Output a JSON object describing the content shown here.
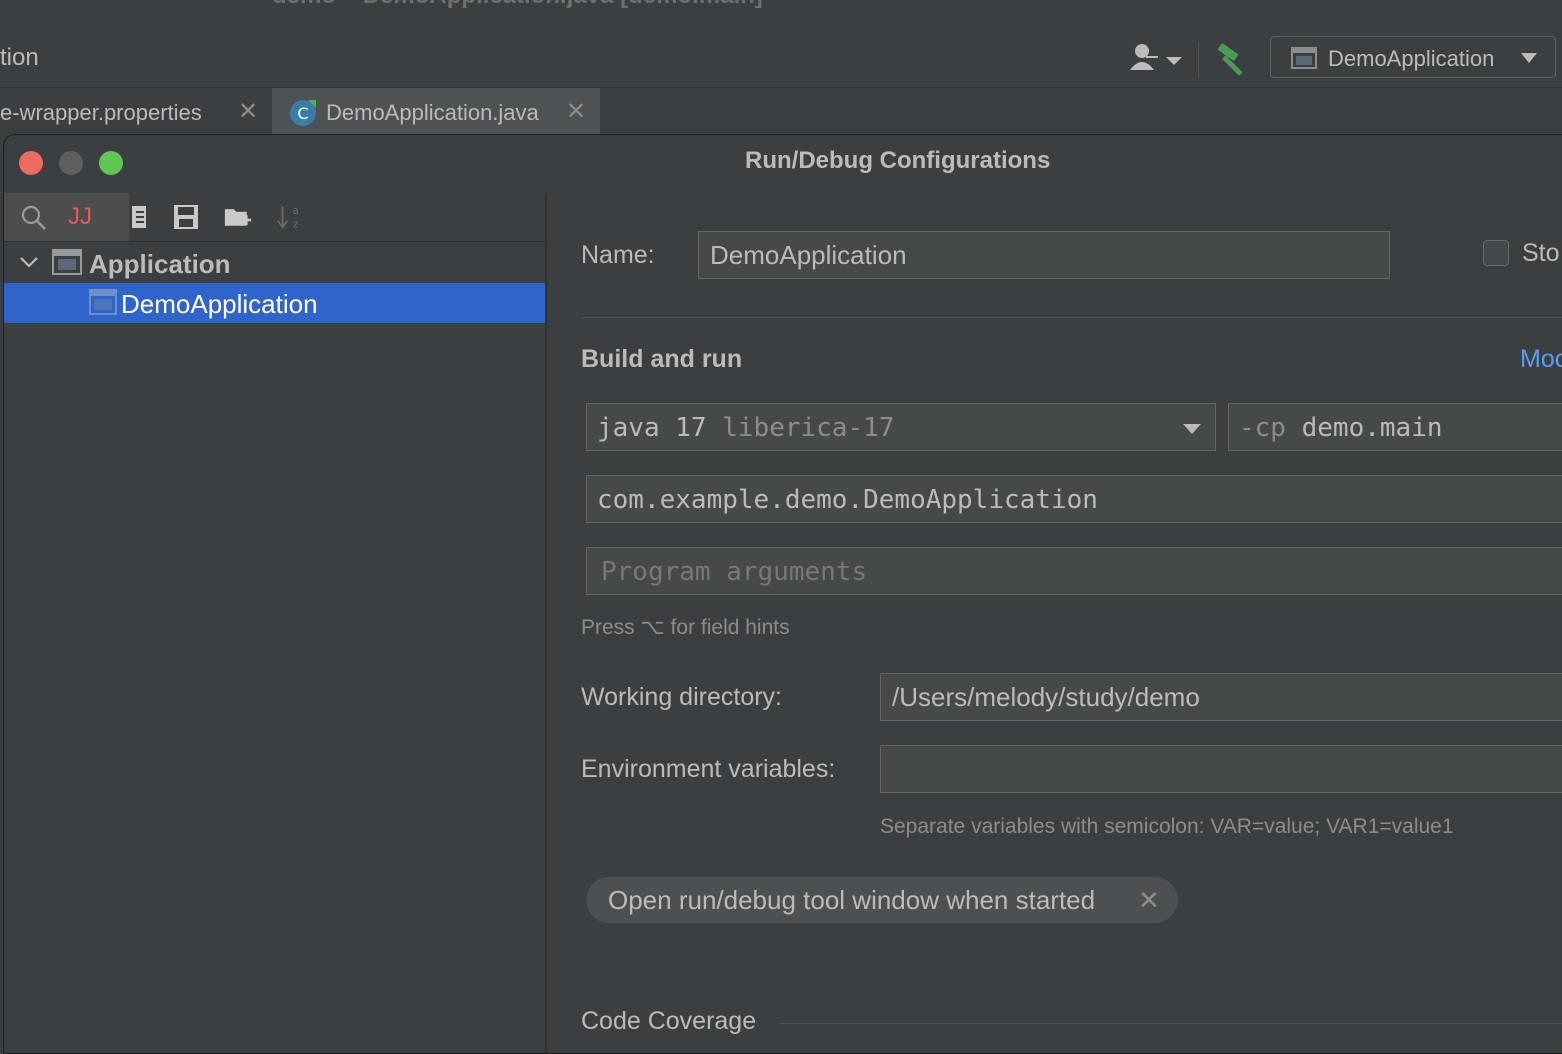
{
  "window": {
    "title": "demo – DemoApplication.java [demo.main]"
  },
  "toolbar": {
    "left_text": "tion",
    "run_config_label": "DemoApplication"
  },
  "tabs": [
    {
      "label": "e-wrapper.properties",
      "close": "✕"
    },
    {
      "label": "DemoApplication.java",
      "close": "✕"
    }
  ],
  "dialog": {
    "title": "Run/Debug Configurations",
    "toolbar_search_glyph": "JJ",
    "tree": {
      "group_label": "Application",
      "item_label": "DemoApplication"
    },
    "form": {
      "name_label": "Name:",
      "name_value": "DemoApplication",
      "store_label": "Sto",
      "build_and_run_title": "Build and run",
      "modify_link": "Moc",
      "jdk": {
        "prefix": "java 17",
        "suffix": "liberica-17"
      },
      "classpath": {
        "prefix": "-cp",
        "value": "demo.main"
      },
      "main_class": "com.example.demo.DemoApplication",
      "program_args_placeholder": "Program arguments",
      "field_hint": "Press ⌥ for field hints",
      "working_dir_label": "Working directory:",
      "working_dir_value": "/Users/melody/study/demo",
      "env_label": "Environment variables:",
      "env_value": "",
      "env_hint": "Separate variables with semicolon: VAR=value; VAR1=value1",
      "chip_label": "Open run/debug tool window when started",
      "chip_close": "✕",
      "code_coverage_title": "Code Coverage"
    }
  },
  "colors": {
    "background": "#3c3f41",
    "selection": "#2f65ca",
    "link": "#589df6",
    "hammer": "#499c54"
  }
}
